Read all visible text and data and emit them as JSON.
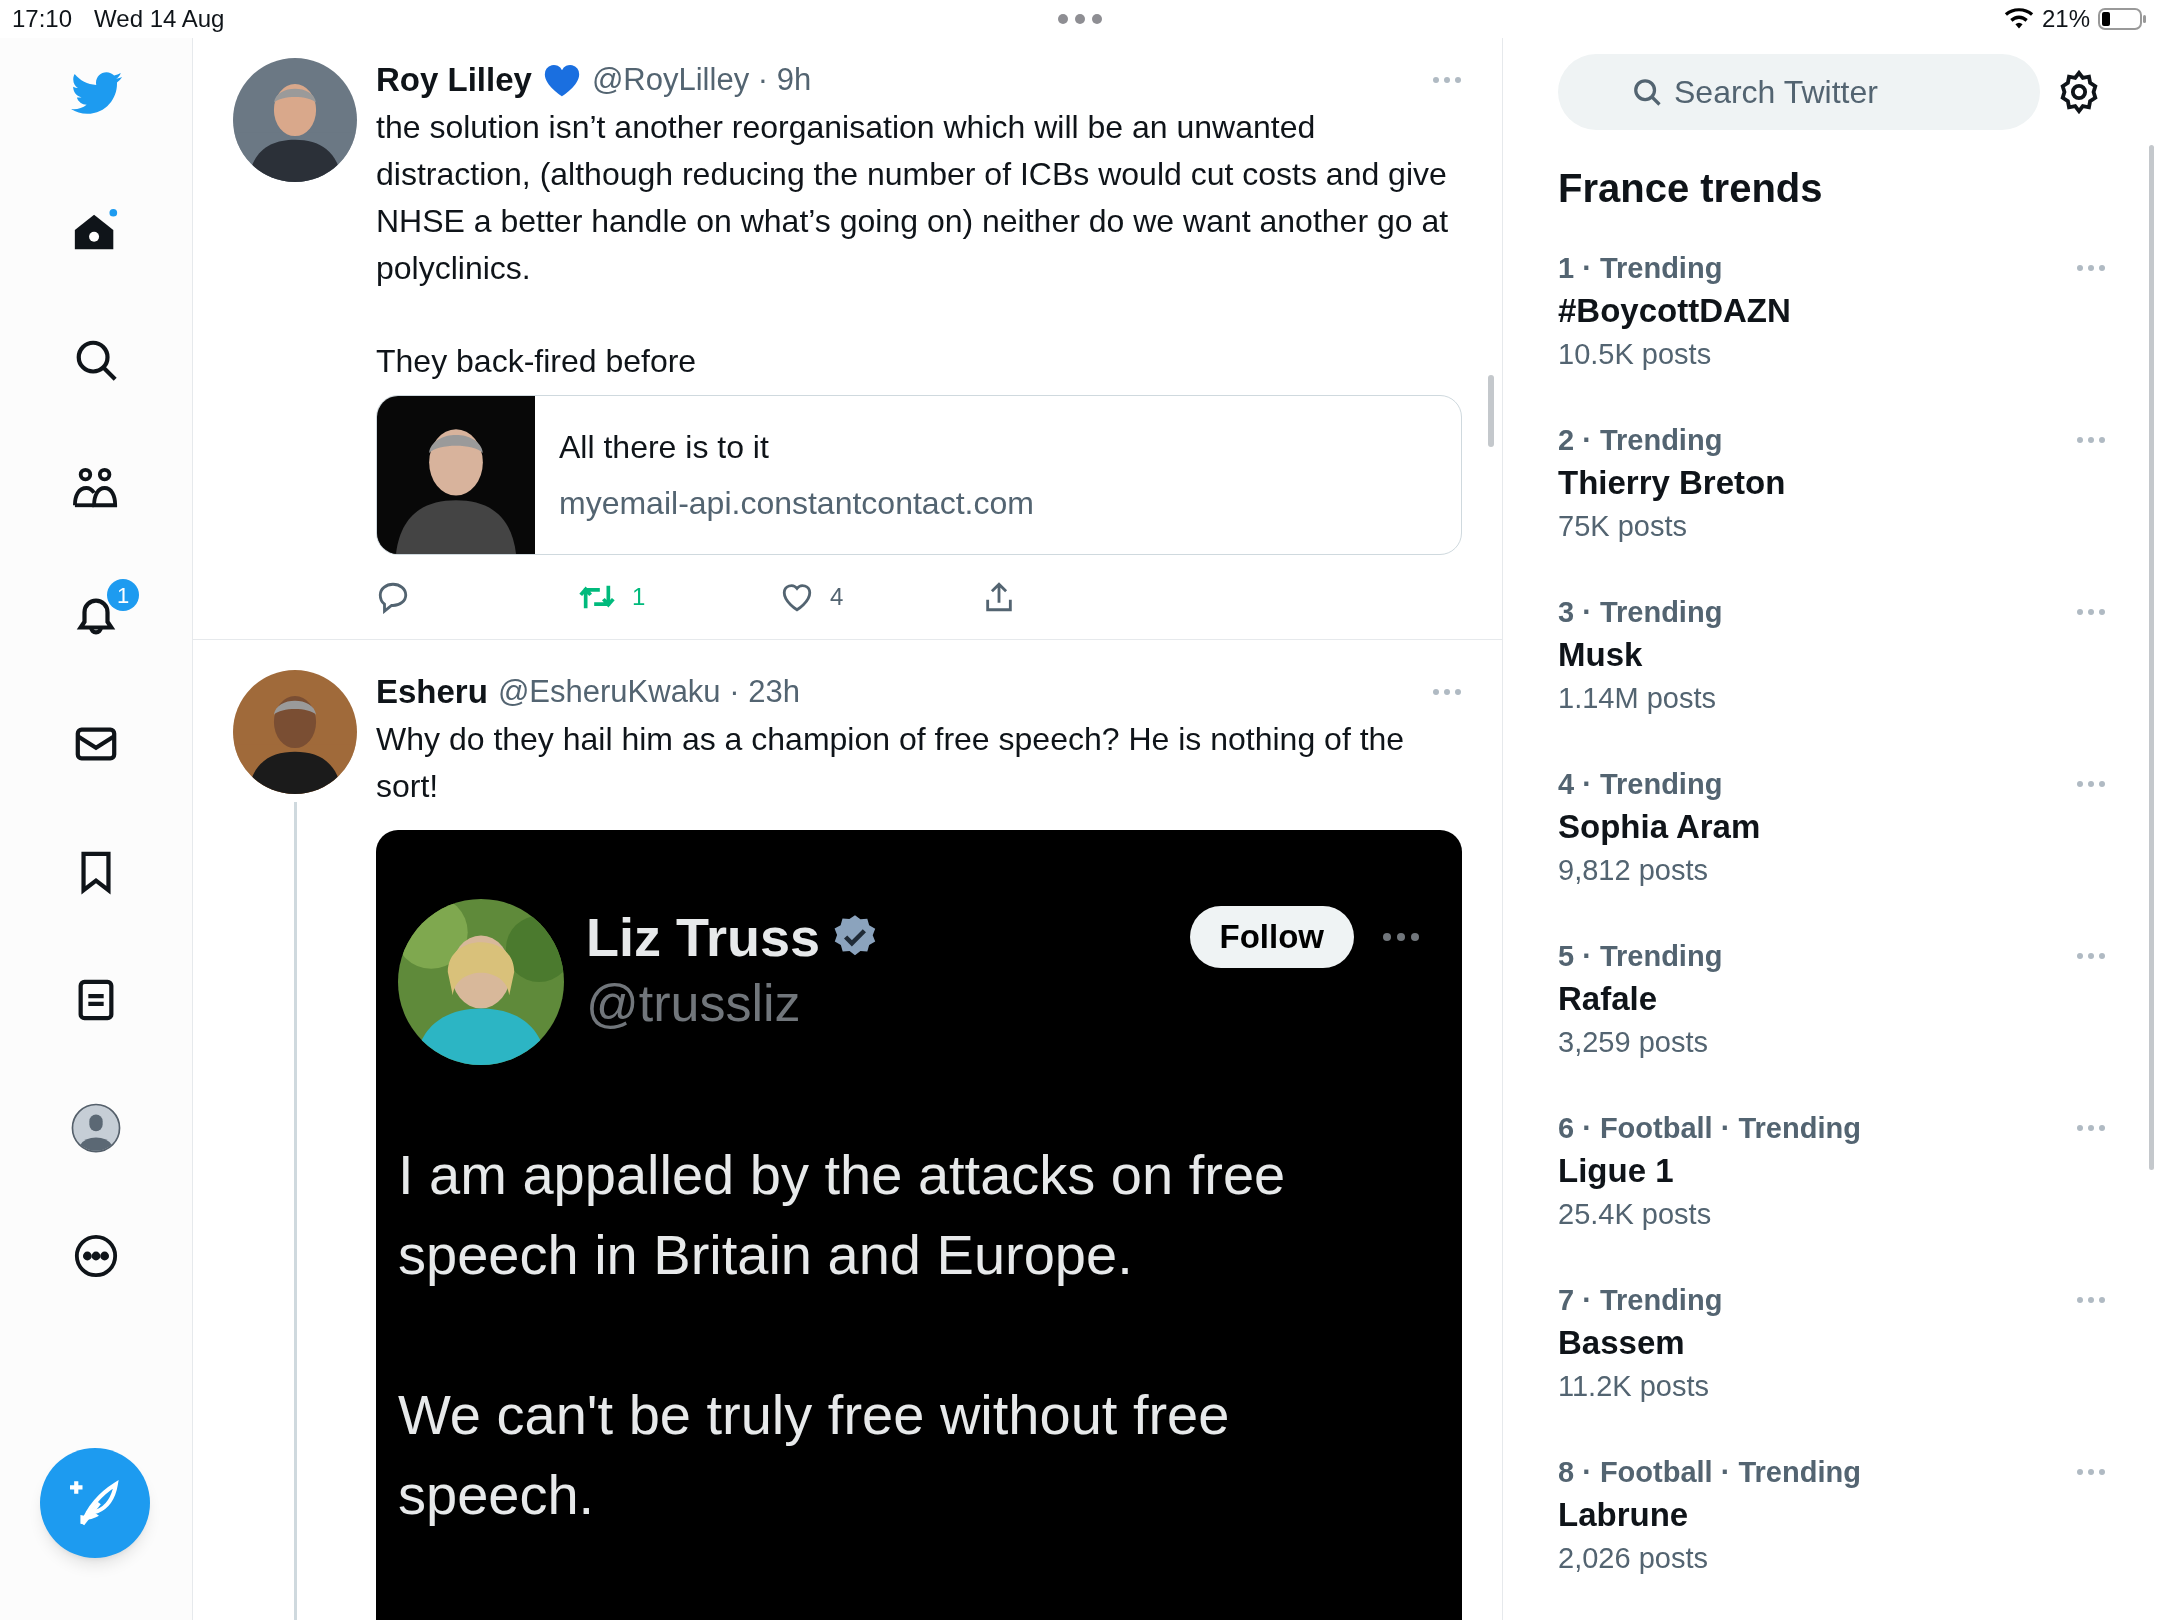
{
  "status_bar": {
    "time": "17:10",
    "date": "Wed 14 Aug",
    "battery": "21%"
  },
  "sidebar": {
    "items": [
      {
        "kind": "home"
      },
      {
        "kind": "search"
      },
      {
        "kind": "communities"
      },
      {
        "kind": "notifications",
        "badge": "1"
      },
      {
        "kind": "messages"
      },
      {
        "kind": "bookmarks"
      },
      {
        "kind": "lists"
      },
      {
        "kind": "profile"
      },
      {
        "kind": "more"
      }
    ]
  },
  "tweets": [
    {
      "author": "Roy Lilley",
      "meta": "@RoyLilley · 9h",
      "paragraphs": [
        "the solution isn’t another reorganisation which will be an unwanted distraction, (although reducing the number of ICBs would cut costs and give NHSE a better handle on what’s going on) neither do we want another go at polyclinics.",
        "They back-fired before"
      ],
      "link_card": {
        "title": "All there is to it",
        "domain": "myemail-api.constantcontact.com"
      },
      "actions": [
        {
          "kind": "reply"
        },
        {
          "kind": "retweet",
          "count": "1",
          "active": true
        },
        {
          "kind": "like",
          "count": "4",
          "active": false
        },
        {
          "kind": "share"
        }
      ]
    },
    {
      "author": "Esheru",
      "meta": "@EsheruKwaku · 23h",
      "thread": true,
      "paragraphs": [
        "Why do they hail him as a champion of free speech? He is nothing of the sort!"
      ],
      "quote": {
        "author": "Liz Truss",
        "handle": "@trussliz",
        "button": "Follow",
        "paragraphs": [
          "I am appalled by the attacks on free speech in Britain and Europe.",
          "We can't be truly free without free speech."
        ]
      }
    }
  ],
  "search": {
    "placeholder": "Search Twitter"
  },
  "trends": {
    "title": "France trends",
    "items": [
      {
        "context": "1 · Trending",
        "name": "#BoycottDAZN",
        "posts": "10.5K posts"
      },
      {
        "context": "2 · Trending",
        "name": "Thierry Breton",
        "posts": "75K posts"
      },
      {
        "context": "3 · Trending",
        "name": "Musk",
        "posts": "1.14M posts"
      },
      {
        "context": "4 · Trending",
        "name": "Sophia Aram",
        "posts": "9,812 posts"
      },
      {
        "context": "5 · Trending",
        "name": "Rafale",
        "posts": "3,259 posts"
      },
      {
        "context": "6 · Football · Trending",
        "name": "Ligue 1",
        "posts": "25.4K posts"
      },
      {
        "context": "7 · Trending",
        "name": "Bassem",
        "posts": "11.2K posts"
      },
      {
        "context": "8 · Football · Trending",
        "name": "Labrune",
        "posts": "2,026 posts"
      }
    ]
  }
}
